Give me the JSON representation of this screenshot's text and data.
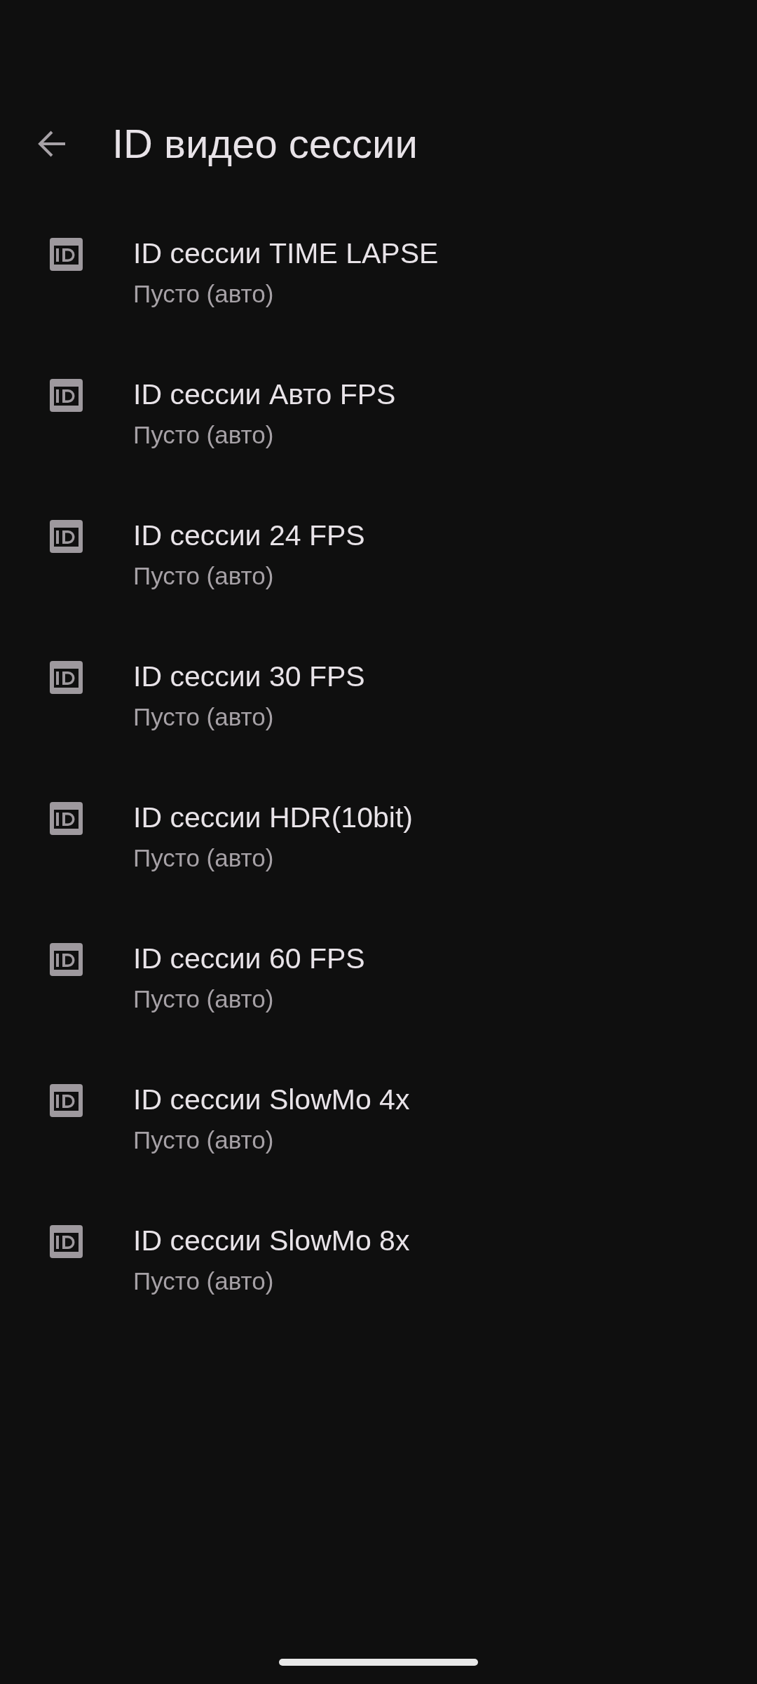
{
  "app_bar": {
    "title": "ID видео сессии"
  },
  "settings": [
    {
      "title": "ID сессии TIME LAPSE",
      "summary": "Пусто (авто)"
    },
    {
      "title": "ID сессии Авто FPS",
      "summary": "Пусто (авто)"
    },
    {
      "title": "ID сессии 24 FPS",
      "summary": "Пусто (авто)"
    },
    {
      "title": "ID сессии 30 FPS",
      "summary": "Пусто (авто)"
    },
    {
      "title": "ID сессии HDR(10bit)",
      "summary": "Пусто (авто)"
    },
    {
      "title": "ID сессии 60 FPS",
      "summary": "Пусто (авто)"
    },
    {
      "title": "ID сессии SlowMo 4x",
      "summary": "Пусто (авто)"
    },
    {
      "title": "ID сессии SlowMo 8x",
      "summary": "Пусто (авто)"
    }
  ]
}
